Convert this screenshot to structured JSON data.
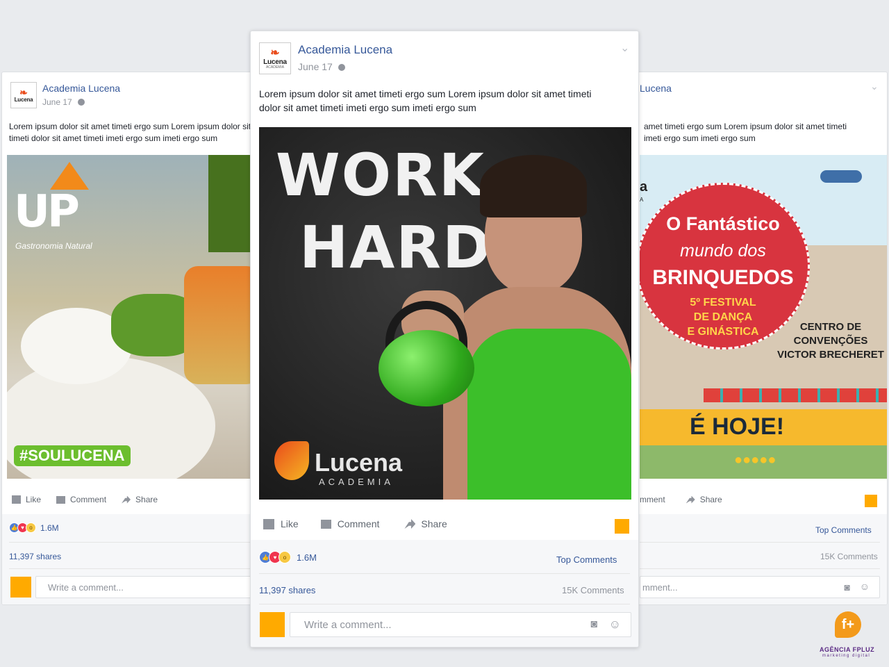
{
  "page": {
    "name": "Academia Lucena",
    "date": "June 17"
  },
  "logo": {
    "word": "Lucena",
    "sub": "ACADEMIA"
  },
  "post_text": "Lorem ipsum dolor sit amet timeti ergo sum Lorem ipsum dolor sit amet timeti dolor sit amet timeti imeti ergo sum imeti ergo sum",
  "left_post": {
    "image": {
      "brand_up": "UP",
      "brand_sub": "Gastronomia Natural",
      "hashtag": "#SOULUCENA"
    }
  },
  "center_post": {
    "image": {
      "headline_1": "WORK",
      "headline_2": "HARD",
      "brand": "Lucena",
      "brand_sub": "ACADEMIA"
    }
  },
  "right_post": {
    "partial_name": "Lucena",
    "partial_text_1": "amet timeti ergo sum Lorem ipsum dolor sit amet timeti",
    "partial_text_2": "imeti ergo sum imeti ergo sum",
    "partial_comment": "mment",
    "partial_placeholder": "mment...",
    "image": {
      "title_1": "O Fantástico",
      "title_2": "mundo dos",
      "title_3": "BRINQUEDOS",
      "subtitle_1": "5º FESTIVAL",
      "subtitle_2": "DE DANÇA",
      "subtitle_3": "E GINÁSTICA",
      "venue_1": "CENTRO DE",
      "venue_2": "CONVENÇÕES",
      "venue_3": "VICTOR BRECHERET",
      "banner": "É HOJE!",
      "logo_partial": "a",
      "logo_partial_sub": "A"
    }
  },
  "actions": {
    "like": "Like",
    "comment": "Comment",
    "share": "Share"
  },
  "stats": {
    "reactions": "1.6M",
    "shares": "11,397 shares",
    "top_comments": "Top Comments",
    "comments": "15K Comments"
  },
  "composer": {
    "placeholder": "Write a comment..."
  },
  "watermark": {
    "name": "AGÊNCIA FPLUZ",
    "sub": "marketing digital",
    "symbol": "f+"
  },
  "colors": {
    "accent": "#ffaa00",
    "link": "#365899",
    "meta": "#90949c",
    "bg": "#e9ebee"
  }
}
